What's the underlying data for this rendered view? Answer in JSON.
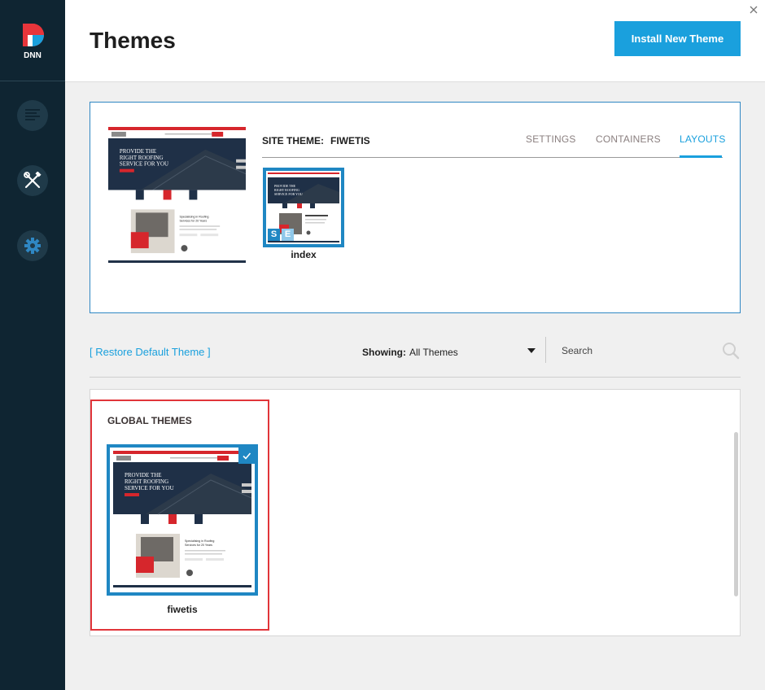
{
  "app": {
    "title": "Themes",
    "logo_text": "DNN",
    "install_button_label": "Install New Theme"
  },
  "sidebar": {
    "items": [
      {
        "name": "content-icon"
      },
      {
        "name": "tools-icon"
      },
      {
        "name": "gear-icon"
      }
    ]
  },
  "site_theme": {
    "label": "SITE THEME:",
    "name": "FIWETIS",
    "tabs": [
      {
        "label": "SETTINGS",
        "active": false
      },
      {
        "label": "CONTAINERS",
        "active": false
      },
      {
        "label": "LAYOUTS",
        "active": true
      }
    ],
    "layouts": [
      {
        "name": "index",
        "badges": [
          "S",
          "E"
        ]
      }
    ]
  },
  "filters": {
    "restore_label": "[ Restore Default Theme ]",
    "showing_label": "Showing:",
    "showing_value": "All Themes",
    "search_placeholder": "Search"
  },
  "global_themes": {
    "title": "GLOBAL THEMES",
    "items": [
      {
        "name": "fiwetis",
        "selected": true
      }
    ]
  },
  "thumbnail": {
    "hero_text": [
      "PROVIDE THE",
      "RIGHT ROOFING",
      "SERVICE FOR YOU"
    ],
    "sub_text": [
      "Specialising in Roofing",
      "Services for 20 Years"
    ]
  },
  "colors": {
    "sidebar": "#0f2532",
    "accent": "#1aa0dd",
    "selection_border": "#1f87c3",
    "highlight": "#e1353a"
  }
}
